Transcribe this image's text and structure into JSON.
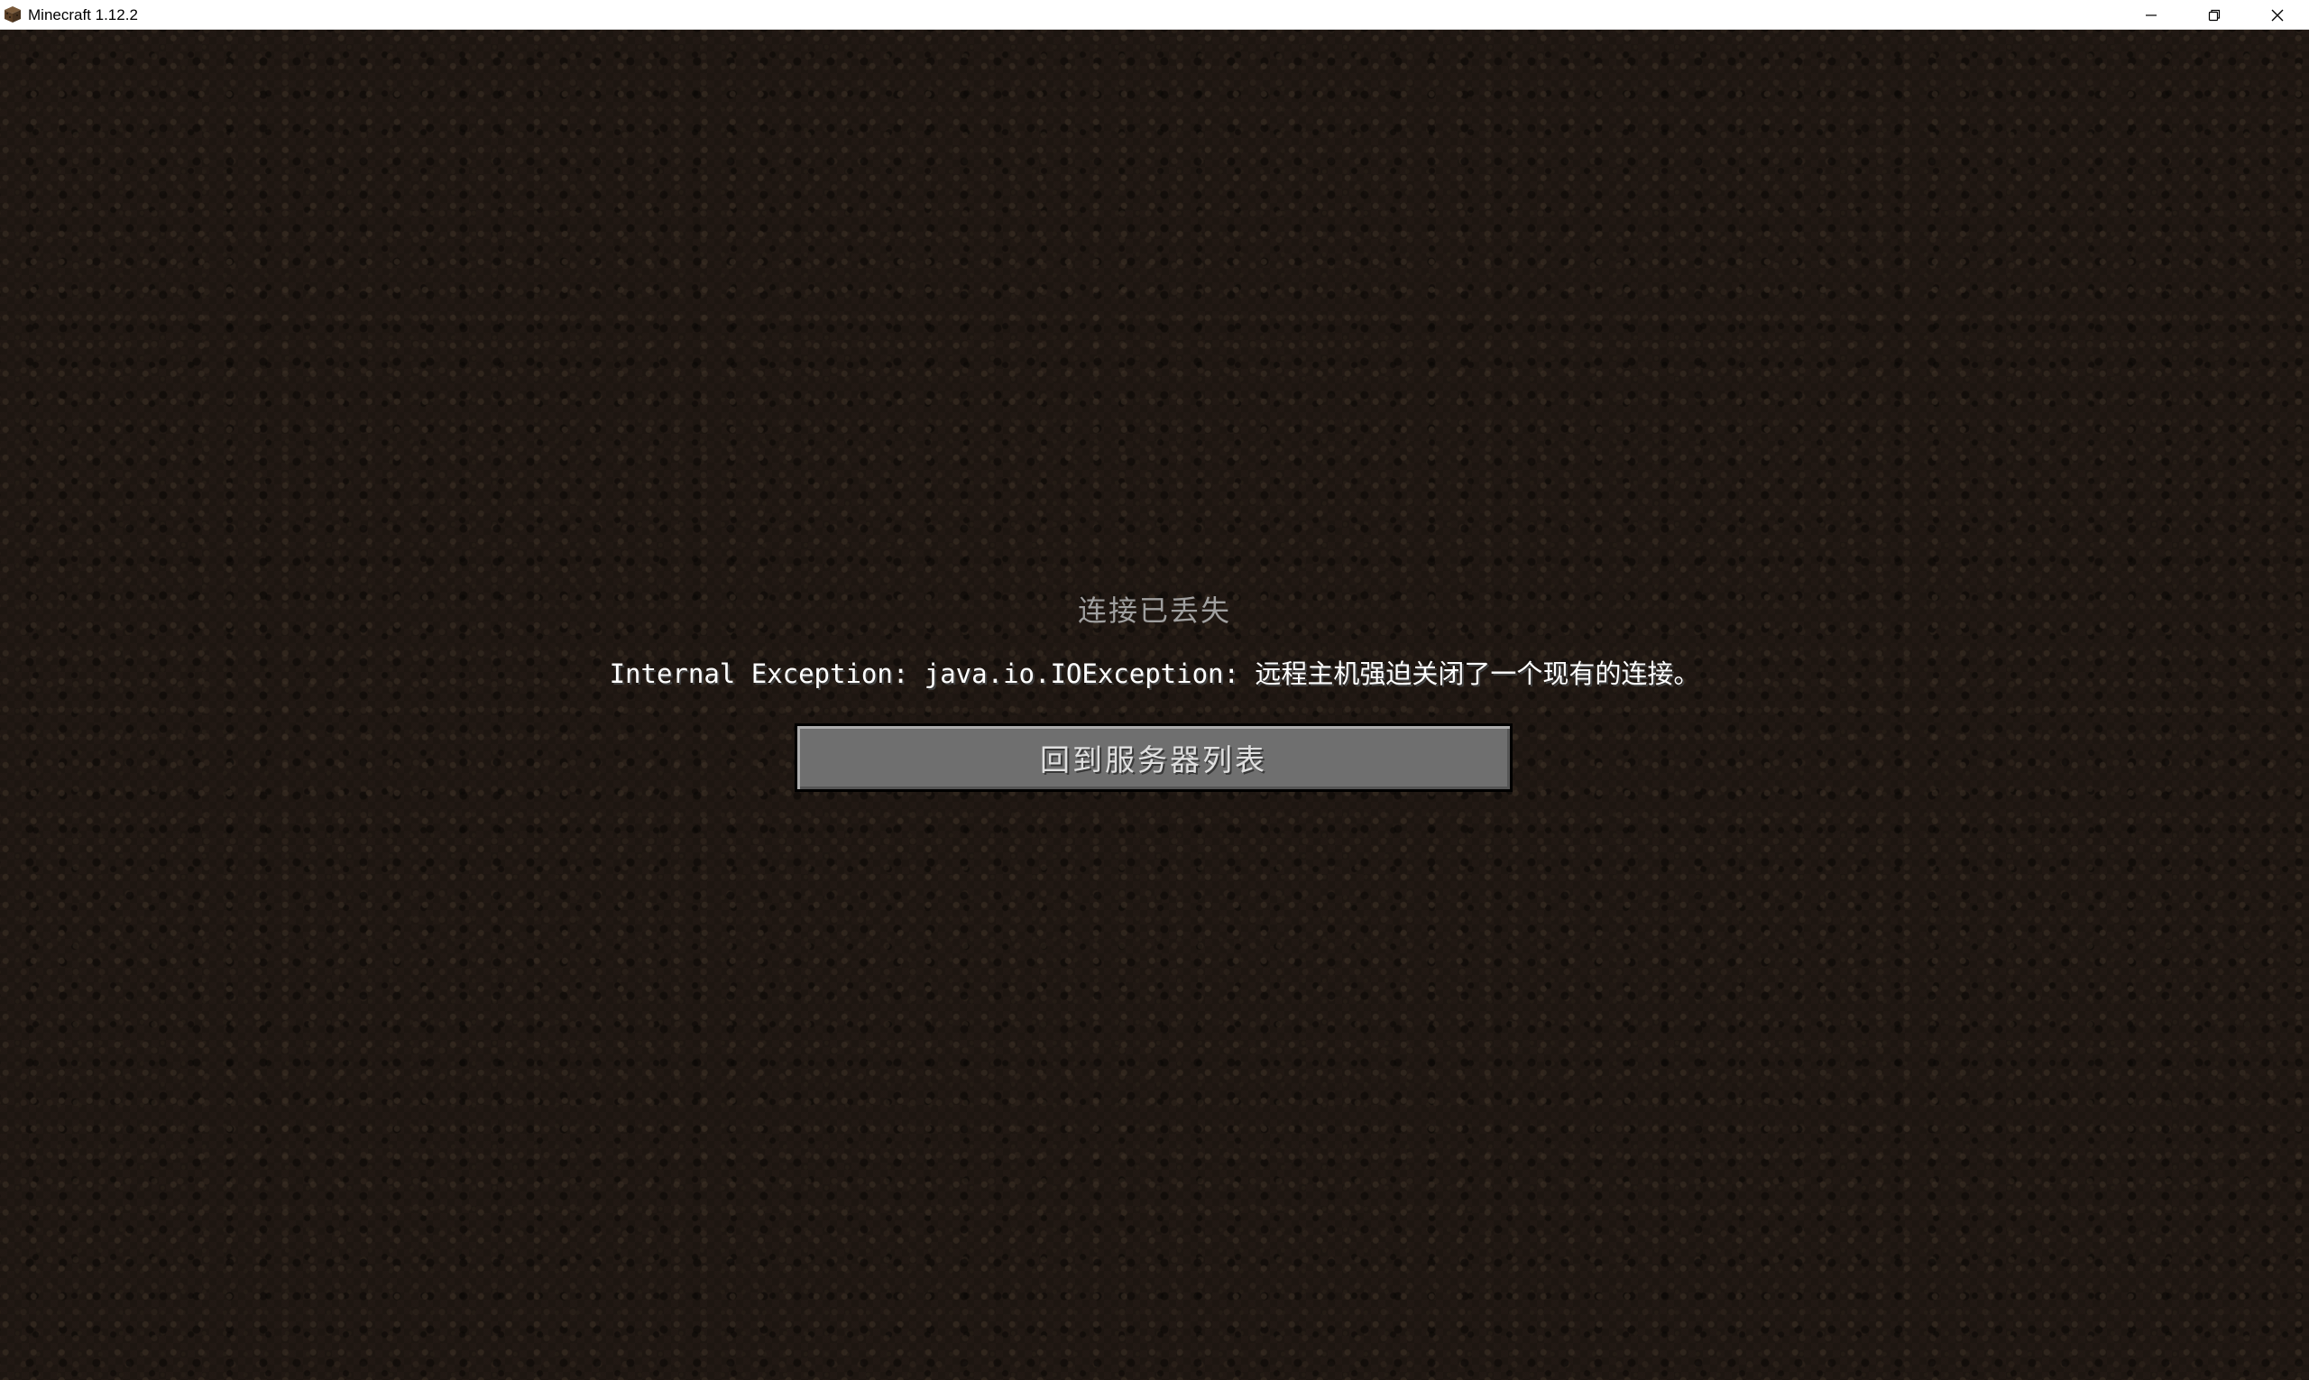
{
  "window": {
    "title": "Minecraft 1.12.2",
    "app_icon": "minecraft-grass-block-icon",
    "controls": {
      "minimize_icon": "minimize-icon",
      "maximize_icon": "restore-icon",
      "close_icon": "close-icon"
    }
  },
  "disconnect_screen": {
    "title": "连接已丢失",
    "reason": "Internal Exception: java.io.IOException: 远程主机强迫关闭了一个现有的连接。",
    "back_button_label": "回到服务器列表"
  },
  "colors": {
    "title_text": "#a0a0a0",
    "reason_text": "#ffffff",
    "button_face": "#6f6f6f",
    "button_text": "#e0e0e0",
    "background": "#221a14"
  }
}
